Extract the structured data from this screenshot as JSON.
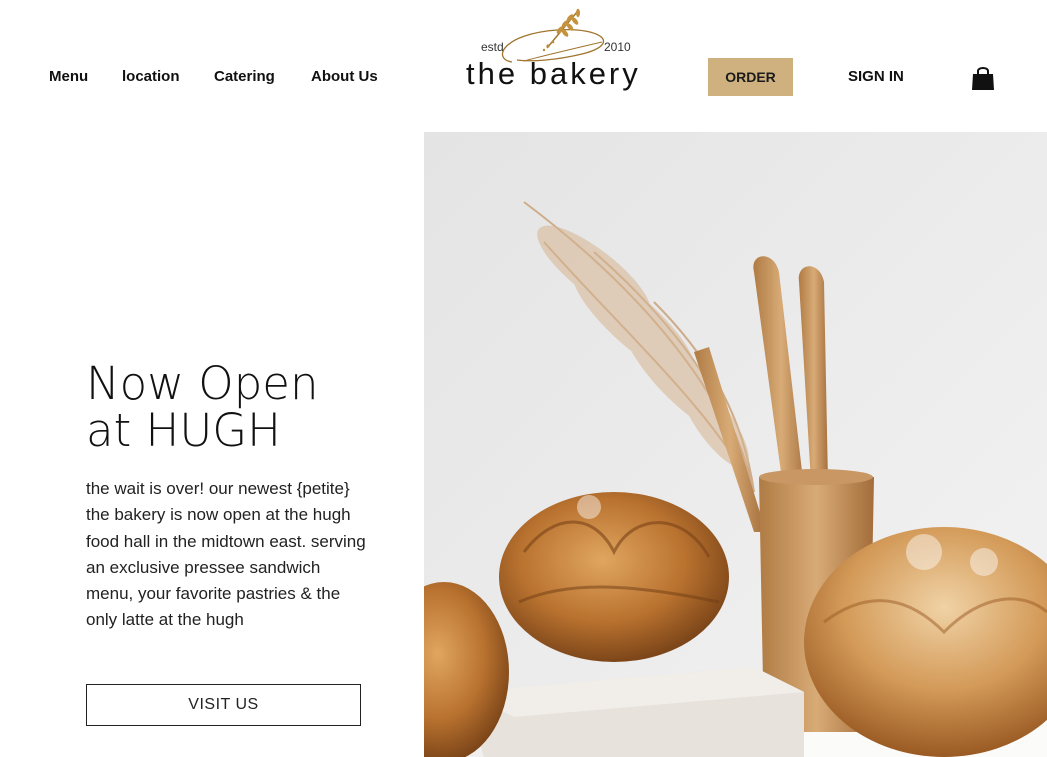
{
  "nav": {
    "links": [
      "Menu",
      "location",
      "Catering",
      "About Us"
    ],
    "order_label": "ORDER",
    "sign_in_label": "SIGN IN",
    "cart_icon": "shopping-bag-icon"
  },
  "logo": {
    "small_left": "estd",
    "small_right": "2010",
    "name": "the bakery"
  },
  "hero": {
    "title_line1": "Now Open",
    "title_line2": "at HUGH",
    "body": "the wait is over! our newest {petite} the bakery is now open at the hugh food hall in the midtown east. serving an exclusive pressee sandwich menu, your favorite pastries & the only latte at the hugh",
    "cta_label": "VISIT US"
  },
  "colors": {
    "accent": "#cfb17f",
    "text": "#111111",
    "background": "#ffffff"
  }
}
